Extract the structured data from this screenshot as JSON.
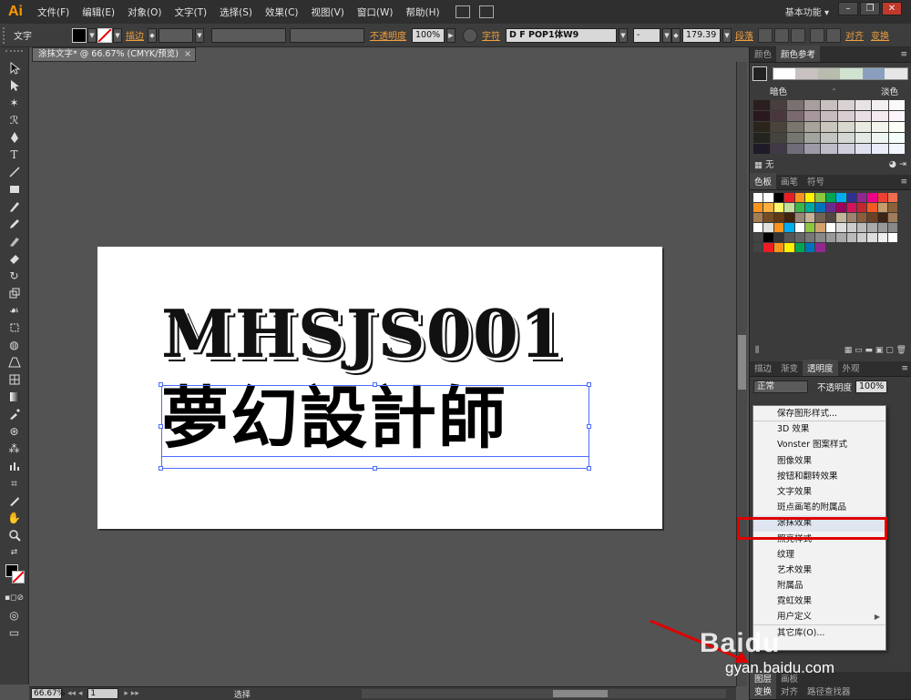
{
  "app": {
    "logo": "Ai",
    "workspace": "基本功能 ▾"
  },
  "menu": [
    "文件(F)",
    "编辑(E)",
    "对象(O)",
    "文字(T)",
    "选择(S)",
    "效果(C)",
    "视图(V)",
    "窗口(W)",
    "帮助(H)"
  ],
  "control_bar": {
    "mode_label": "文字",
    "stroke_link": "描边",
    "opacity_link": "不透明度",
    "opacity_value": "100%",
    "char_link": "字符",
    "font_name": "D F POP1体W9",
    "font_style": "-",
    "font_size": "179.39",
    "para_link": "段落",
    "align_link": "对齐",
    "transform_link": "变换"
  },
  "document": {
    "tab_title": "涂抹文字* @ 66.67% (CMYK/预览)",
    "close": "×"
  },
  "artwork": {
    "title": "MHSJS001",
    "chinese": "夢幻設計師"
  },
  "status": {
    "zoom": "66.67%",
    "artboard": "1",
    "tool": "选择"
  },
  "panels": {
    "color_tabs": [
      "颜色",
      "颜色参考"
    ],
    "guide": {
      "left_label": "暗色",
      "right_label": "淡色",
      "foot_label": "无"
    },
    "swatch_tabs": [
      "色板",
      "画笔",
      "符号"
    ],
    "trans_tabs": [
      "描边",
      "渐变",
      "透明度",
      "外观"
    ],
    "blend_mode": "正常",
    "opacity_label": "不透明度",
    "opacity_value": "100%",
    "layer_tabs": [
      "图层",
      "画板"
    ],
    "bottom_tabs": [
      "变换",
      "对齐",
      "路径查找器"
    ]
  },
  "popup_menu": {
    "items": [
      "保存图形样式...",
      "3D 效果",
      "Vonster 图案样式",
      "图像效果",
      "按钮和翻转效果",
      "文字效果",
      "斑点画笔的附属品",
      "涂抹效果",
      "照亮样式",
      "纹理",
      "艺术效果",
      "附属品",
      "霓虹效果",
      "用户定义",
      "其它库(O)..."
    ],
    "highlighted": "涂抹效果"
  },
  "watermark": {
    "brand": "Baidu",
    "url": "gyan.baidu.com"
  },
  "colors": {
    "accent": "#f0a040",
    "highlight": "#e00000",
    "selection": "#4a6cff"
  }
}
